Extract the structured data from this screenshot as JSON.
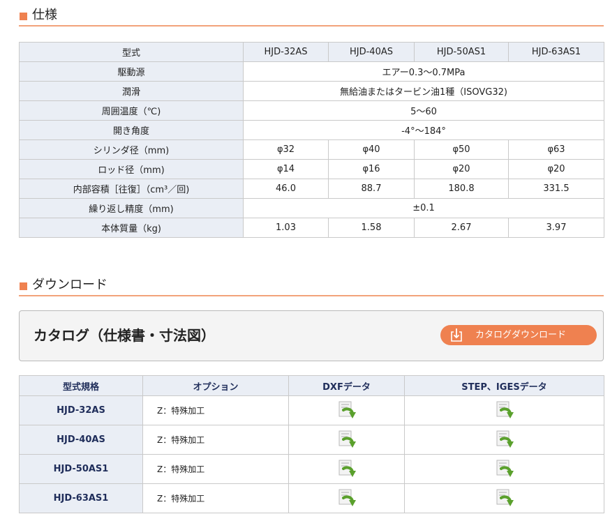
{
  "spec_section": {
    "heading": "仕様",
    "header_row": {
      "label": "型式",
      "models": [
        "HJD-32AS",
        "HJD-40AS",
        "HJD-50AS1",
        "HJD-63AS1"
      ]
    },
    "rows": [
      {
        "label": "駆動源",
        "value": "エアー0.3〜0.7MPa"
      },
      {
        "label": "潤滑",
        "value": "無給油またはタービン油1種（ISOVG32)"
      },
      {
        "label": "周囲温度（℃)",
        "value": "5〜60"
      },
      {
        "label": "開き角度",
        "value": "-4°〜184°"
      },
      {
        "label": "シリンダ径（mm)",
        "values": [
          "φ32",
          "φ40",
          "φ50",
          "φ63"
        ]
      },
      {
        "label": "ロッド径（mm)",
        "values": [
          "φ14",
          "φ16",
          "φ20",
          "φ20"
        ]
      },
      {
        "label": "内部容積［往復］（cm³／回)",
        "values": [
          "46.0",
          "88.7",
          "180.8",
          "331.5"
        ]
      },
      {
        "label": "繰り返し精度（mm)",
        "value": "±0.1"
      },
      {
        "label": "本体質量（kg)",
        "values": [
          "1.03",
          "1.58",
          "2.67",
          "3.97"
        ]
      }
    ]
  },
  "download_section": {
    "heading": "ダウンロード",
    "catalog_title": "カタログ（仕様書・寸法図）",
    "catalog_button": "カタログダウンロード",
    "table_headers": [
      "型式規格",
      "オプション",
      "DXFデータ",
      "STEP、IGESデータ"
    ],
    "rows": [
      {
        "model": "HJD-32AS",
        "option": "Z：特殊加工"
      },
      {
        "model": "HJD-40AS",
        "option": "Z：特殊加工"
      },
      {
        "model": "HJD-50AS1",
        "option": "Z：特殊加工"
      },
      {
        "model": "HJD-63AS1",
        "option": "Z：特殊加工"
      }
    ]
  },
  "icons": {
    "download": "download-arrow-icon",
    "file_download": "file-download-icon"
  },
  "colors": {
    "accent": "#ef8150",
    "header_bg": "#eaeef5",
    "model_text": "#1f2d5a"
  }
}
